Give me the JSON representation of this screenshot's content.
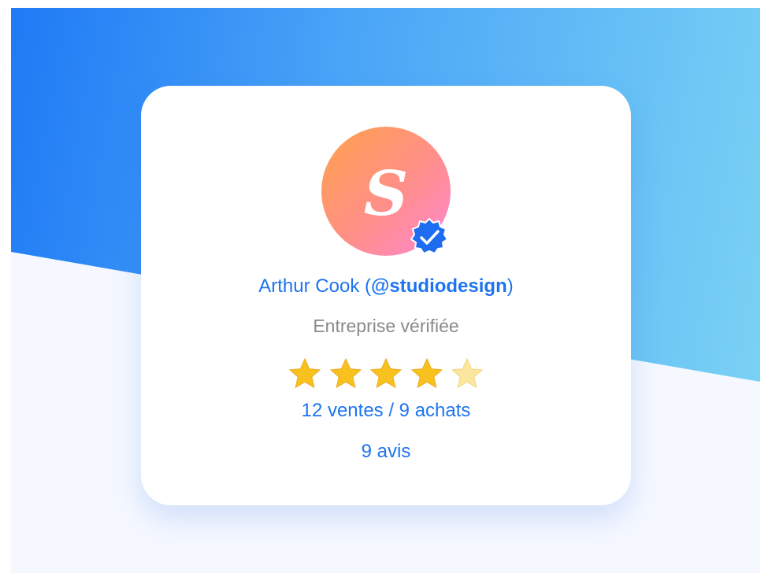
{
  "profile": {
    "name": "Arthur Cook",
    "handle_open": " (",
    "handle": "@studiodesign",
    "handle_close": ")",
    "subtitle": "Entreprise vérifiée",
    "monogram": "S",
    "verified": true,
    "rating": 4.5,
    "rating_max": 5,
    "stats": "12 ventes / 9 achats",
    "reviews": "9 avis"
  },
  "colors": {
    "accent": "#1e74ef",
    "subtitle": "#8a8a8a",
    "star": "#f7c21e",
    "avatar_gradient": [
      "#ffa14a",
      "#ff86d4"
    ]
  },
  "icons": {
    "verified": "verified-badge-icon",
    "star": "star-icon"
  }
}
